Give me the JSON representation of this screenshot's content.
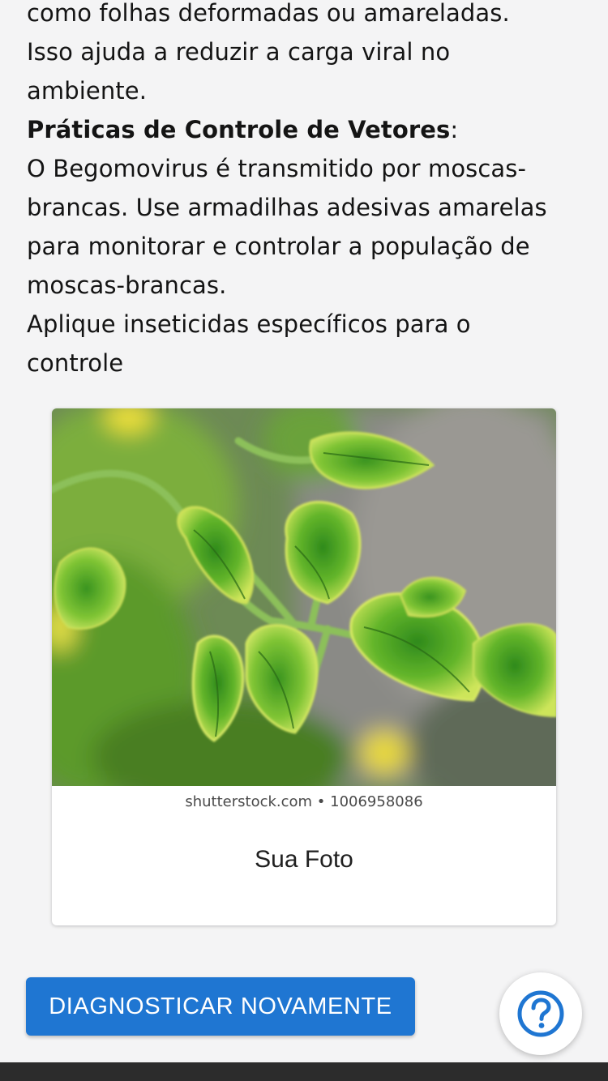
{
  "article": {
    "line1": "como folhas deformadas ou amareladas.",
    "line2": "Isso ajuda a reduzir a carga viral no",
    "line3": "ambiente.",
    "heading": "Práticas de Controle de Vetores",
    "heading_colon": ":",
    "para2_line1": "O Begomovirus é transmitido por moscas-",
    "para2_line2": "brancas. Use armadilhas adesivas amarelas",
    "para2_line3": "para monitorar e controlar a população de",
    "para2_line4": "moscas-brancas.",
    "para3_line1": "Aplique inseticidas específicos para o",
    "para3_line2": "controle"
  },
  "photo_card": {
    "watermark": "shutterstock.com • 1006958086",
    "caption": "Sua Foto"
  },
  "actions": {
    "diagnose_again_label": "DIAGNOSTICAR NOVAMENTE",
    "help_icon": "question-circle-icon"
  },
  "colors": {
    "primary": "#1f76d2",
    "background": "#f4f4f5",
    "bottom_bar": "#2c2c2c"
  }
}
